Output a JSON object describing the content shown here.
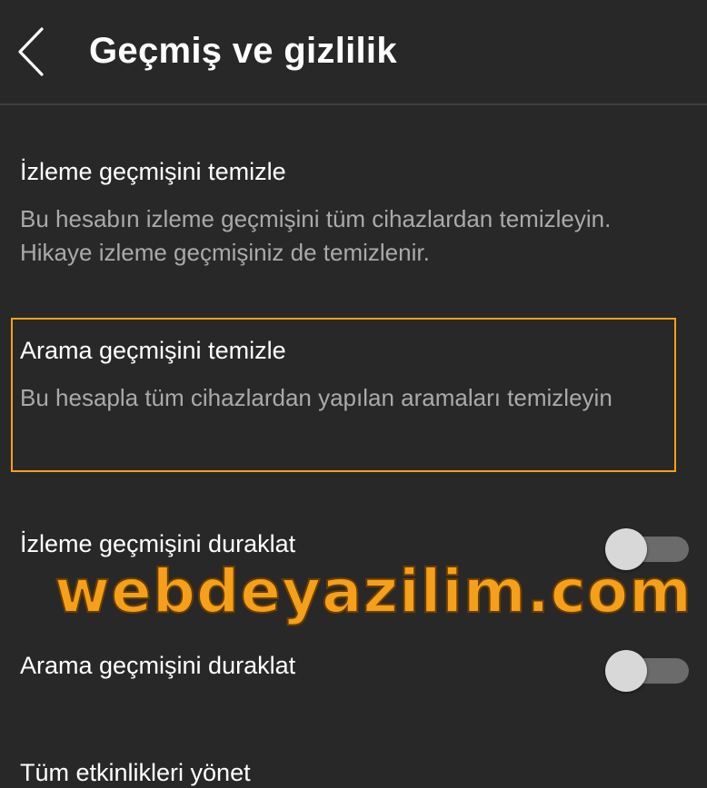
{
  "header": {
    "title": "Geçmiş ve gizlilik",
    "back_icon": "chevron-left-icon"
  },
  "settings": [
    {
      "title": "İzleme geçmişini temizle",
      "description": "Bu hesabın izleme geçmişini tüm cihazlardan temizleyin. Hikaye izleme geçmişiniz de temizlenir."
    },
    {
      "title": "Arama geçmişini temizle",
      "description": "Bu hesapla tüm cihazlardan yapılan aramaları temizleyin",
      "highlighted": true
    }
  ],
  "toggles": [
    {
      "label": "İzleme geçmişini duraklat",
      "on": false
    },
    {
      "label": "Arama geçmişini duraklat",
      "on": false
    }
  ],
  "manage": {
    "label": "Tüm etkinlikleri yönet"
  },
  "watermark": {
    "text": "webdeyazilim.com"
  },
  "colors": {
    "background": "#282828",
    "highlight": "#f5a01a",
    "secondary_text": "#aaaaaa"
  }
}
